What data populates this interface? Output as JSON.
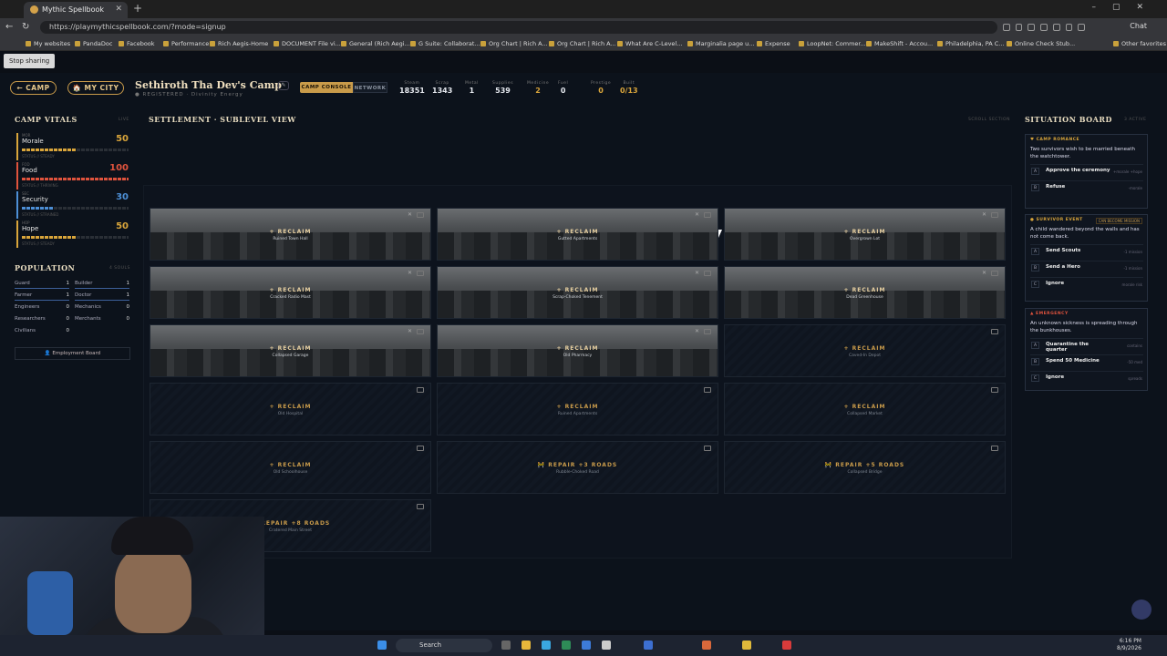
{
  "browser": {
    "tab_title": "Mythic Spellbook",
    "url": "https://playmythicspellbook.com/?mode=signup",
    "chat": "Chat",
    "share": "Stop sharing",
    "bookmarks": [
      "My websites",
      "PandaDoc",
      "Facebook",
      "Performance",
      "Rich Aegis-Home",
      "DOCUMENT File vi...",
      "General (Rich Aegi...",
      "G Suite: Collaborat...",
      "Org Chart | Rich A...",
      "Org Chart | Rich A...",
      "What Are C-Level...",
      "Marginalia page u...",
      "Expense",
      "LoopNet: Commer...",
      "MakeShift - Accou...",
      "Philadelphia, PA C...",
      "Online Check Stub...",
      "Other favorites"
    ]
  },
  "header": {
    "camp_btn": "← CAMP",
    "city_btn": "🏠 MY CITY",
    "title": "Sethiroth Tha Dev's Camp",
    "subtitle": "● REGISTERED · Divinity Energy",
    "seg_active": "CAMP CONSOLE",
    "seg_inactive": "NETWORK",
    "stats": [
      {
        "l": "Steam",
        "v": "18351",
        "c": "#e5e8ee"
      },
      {
        "l": "Scrap",
        "v": "1343",
        "c": "#e5e8ee"
      },
      {
        "l": "Metal",
        "v": "1",
        "c": "#e5e8ee"
      },
      {
        "l": "Supplies",
        "v": "539",
        "c": "#e5e8ee"
      },
      {
        "l": "Medicine",
        "v": "2",
        "c": "#d9a53b"
      },
      {
        "l": "Fuel",
        "v": "0",
        "c": "#e5e8ee"
      },
      {
        "l": "Prestige",
        "v": "0",
        "c": "#d9a53b"
      },
      {
        "l": "Built",
        "v": "0/13",
        "c": "#d9a53b"
      }
    ]
  },
  "vitals": {
    "title": "CAMP VITALS",
    "tag": "LIVE",
    "items": [
      {
        "k": "MOR",
        "name": "Morale",
        "value": "50",
        "pct": 0.5,
        "color": "#d9a53b",
        "status": "STATUS // STEADY"
      },
      {
        "k": "FOD",
        "name": "Food",
        "value": "100",
        "pct": 1.0,
        "color": "#e0533d",
        "status": "STATUS // THRIVING"
      },
      {
        "k": "SEC",
        "name": "Security",
        "value": "30",
        "pct": 0.3,
        "color": "#4d8fd6",
        "status": "STATUS // STRAINED"
      },
      {
        "k": "HOP",
        "name": "Hope",
        "value": "50",
        "pct": 0.5,
        "color": "#d9a53b",
        "status": "STATUS // STEADY"
      }
    ]
  },
  "population": {
    "title": "POPULATION",
    "tag": "4 SOULS",
    "rows": [
      [
        "Guard",
        "1",
        "Builder",
        "1"
      ],
      [
        "Farmer",
        "1",
        "Doctor",
        "1"
      ],
      [
        "Engineers",
        "0",
        "Mechanics",
        "0"
      ],
      [
        "Researchers",
        "0",
        "Merchants",
        "0"
      ],
      [
        "Civilians",
        "0",
        "",
        ""
      ]
    ],
    "employment": "👤 Employment Board"
  },
  "settlement": {
    "title": "SETTLEMENT · SUBLEVEL VIEW",
    "tag": "SCROLL SECTION",
    "tiles": [
      {
        "l": "+ RECLAIM",
        "s": "Ruined Town Hall",
        "img": true
      },
      {
        "l": "+ RECLAIM",
        "s": "Gutted Apartments",
        "img": true
      },
      {
        "l": "+ RECLAIM",
        "s": "Overgrown Lot",
        "img": true
      },
      {
        "l": "+ RECLAIM",
        "s": "Cracked Radio Mast",
        "img": true
      },
      {
        "l": "+ RECLAIM",
        "s": "Scrap-Choked Tenement",
        "img": true
      },
      {
        "l": "+ RECLAIM",
        "s": "Dead Greenhouse",
        "img": true
      },
      {
        "l": "+ RECLAIM",
        "s": "Collapsed Garage",
        "img": true
      },
      {
        "l": "+ RECLAIM",
        "s": "Old Pharmacy",
        "img": true
      },
      {
        "l": "+ RECLAIM",
        "s": "Caved-In Depot",
        "img": false
      },
      {
        "l": "+ RECLAIM",
        "s": "Old Hospital",
        "img": false
      },
      {
        "l": "+ RECLAIM",
        "s": "Ruined Apartments",
        "img": false
      },
      {
        "l": "+ RECLAIM",
        "s": "Collapsed Market",
        "img": false
      },
      {
        "l": "+ RECLAIM",
        "s": "Old Schoolhouse",
        "img": false
      },
      {
        "l": "🚧 REPAIR +3 ROADS",
        "s": "Rubble-Choked Road",
        "img": false
      },
      {
        "l": "🚧 REPAIR +5 ROADS",
        "s": "Collapsed Bridge",
        "img": false
      },
      {
        "l": "🚧 REPAIR +8 ROADS",
        "s": "Cratered Main Street",
        "img": false
      }
    ]
  },
  "situation": {
    "title": "SITUATION BOARD",
    "tag": "3 ACTIVE",
    "cards": [
      {
        "tag": "♥ CAMP ROMANCE",
        "tagcolor": "#d9a53b",
        "badge": "",
        "text": "Two survivors wish to be married beneath the watchtower.",
        "opts": [
          [
            "A",
            "Approve the ceremony",
            "+morale +hope"
          ],
          [
            "B",
            "Refuse",
            "-morale"
          ]
        ]
      },
      {
        "tag": "● SURVIVOR EVENT",
        "tagcolor": "#d9a53b",
        "badge": "CAN BECOME MISSION",
        "text": "A child wandered beyond the walls and has not come back.",
        "opts": [
          [
            "A",
            "Send Scouts",
            "-1 mission"
          ],
          [
            "B",
            "Send a Hero",
            "-1 mission"
          ],
          [
            "C",
            "Ignore",
            "morale risk"
          ]
        ]
      },
      {
        "tag": "▲ EMERGENCY",
        "tagcolor": "#e0533d",
        "badge": "",
        "text": "An unknown sickness is spreading through the bunkhouses.",
        "opts": [
          [
            "A",
            "Quarantine the quarter",
            "contains"
          ],
          [
            "B",
            "Spend 50 Medicine",
            "-50 med"
          ],
          [
            "C",
            "Ignore",
            "spreads"
          ]
        ]
      }
    ]
  },
  "taskbar": {
    "search": "Search",
    "time": "6:16 PM",
    "date": "8/9/2026"
  }
}
